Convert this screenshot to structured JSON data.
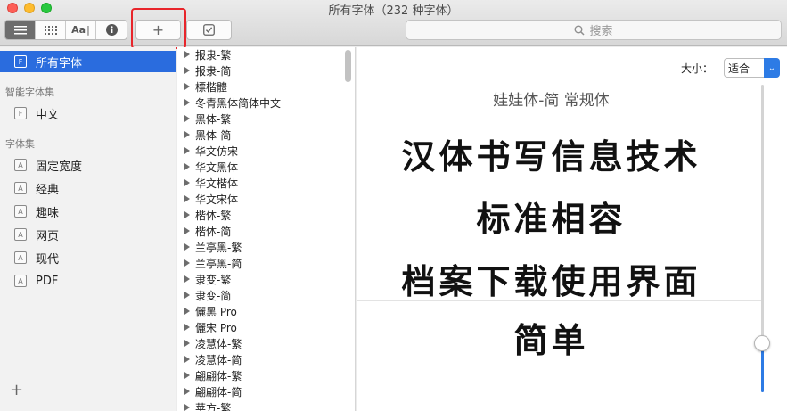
{
  "window": {
    "title": "所有字体（232 种字体）"
  },
  "toolbar": {
    "view_modes": [
      {
        "name": "list-view",
        "icon": "list-icon",
        "active": true
      },
      {
        "name": "grid-view",
        "icon": "grid-icon",
        "active": false
      },
      {
        "name": "sample-view",
        "icon": "text-sample-icon",
        "label": "Aa",
        "active": false
      },
      {
        "name": "info-view",
        "icon": "info-icon",
        "active": false
      }
    ],
    "add_label": "+",
    "validate_icon": "checkbox-icon",
    "search_placeholder": "搜索"
  },
  "sidebar": {
    "all_fonts": "所有字体",
    "smart_section": "智能字体集",
    "smart_items": [
      "中文"
    ],
    "collections_section": "字体集",
    "collections": [
      "固定宽度",
      "经典",
      "趣味",
      "网页",
      "现代",
      "PDF"
    ],
    "add_label": "+"
  },
  "fontlist": {
    "items": [
      "报隶-繁",
      "报隶-简",
      "標楷體",
      "冬青黑体简体中文",
      "黑体-繁",
      "黑体-简",
      "华文仿宋",
      "华文黑体",
      "华文楷体",
      "华文宋体",
      "楷体-繁",
      "楷体-简",
      "兰亭黑-繁",
      "兰亭黑-简",
      "隶变-繁",
      "隶变-简",
      "儷黑 Pro",
      "儷宋 Pro",
      "凌慧体-繁",
      "凌慧体-简",
      "翩翩体-繁",
      "翩翩体-简",
      "苹方-繁"
    ]
  },
  "preview": {
    "size_label": "大小：",
    "size_value": "适合",
    "font_name": "娃娃体-简 常规体",
    "sample_lines": [
      "汉体书写信息技术",
      "标准相容",
      "档案下载使用界面",
      "简单"
    ],
    "slider_value_percent": 16
  },
  "colors": {
    "accent": "#2a6cde",
    "highlight_box": "#e8252b"
  }
}
